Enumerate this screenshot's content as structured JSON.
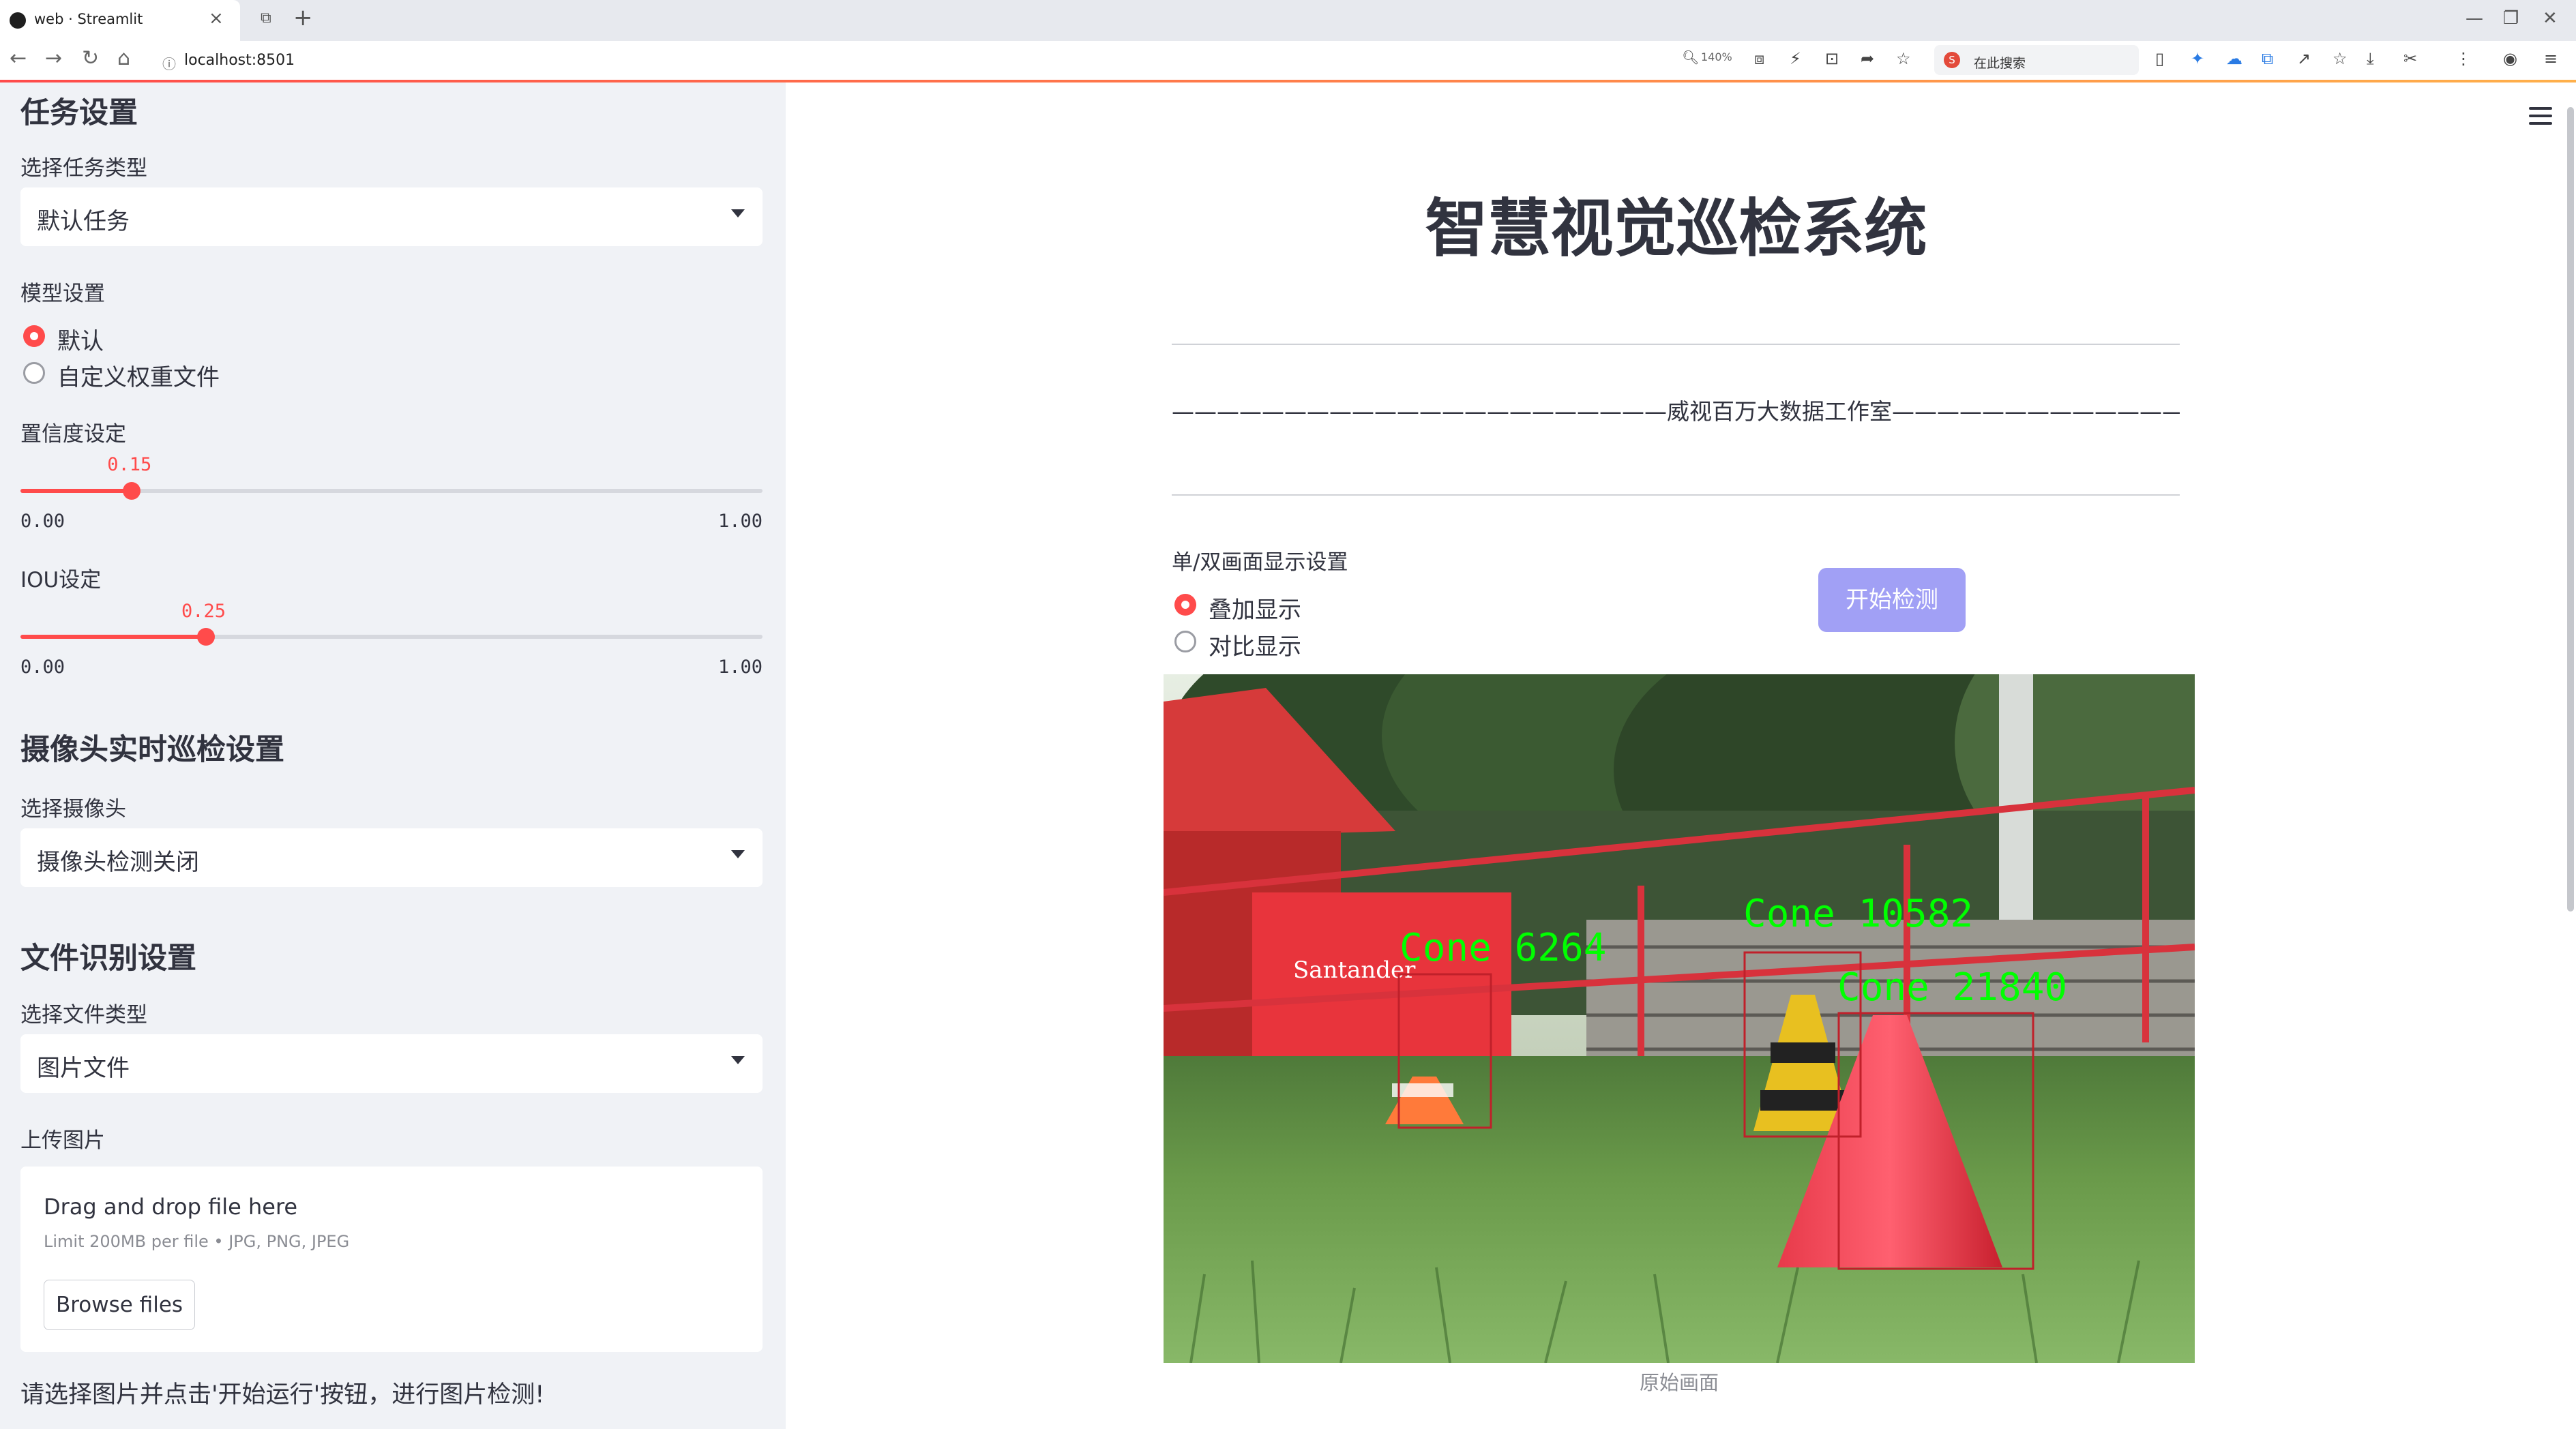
{
  "browser": {
    "tab_title": "web · Streamlit",
    "url": "localhost:8501",
    "zoom": "140%",
    "search_placeholder": "在此搜索"
  },
  "sidebar": {
    "task_section": {
      "heading": "任务设置",
      "select_label": "选择任务类型",
      "select_value": "默认任务"
    },
    "model_section": {
      "label": "模型设置",
      "options": [
        "默认",
        "自定义权重文件"
      ],
      "selected_index": 0
    },
    "confidence": {
      "label": "置信度设定",
      "value": "0.15",
      "value_num": 0.15,
      "min": "0.00",
      "max": "1.00"
    },
    "iou": {
      "label": "IOU设定",
      "value": "0.25",
      "value_num": 0.25,
      "min": "0.00",
      "max": "1.00"
    },
    "camera_section": {
      "heading": "摄像头实时巡检设置",
      "select_label": "选择摄像头",
      "select_value": "摄像头检测关闭"
    },
    "file_section": {
      "heading": "文件识别设置",
      "select_label": "选择文件类型",
      "select_value": "图片文件"
    },
    "upload": {
      "label": "上传图片",
      "drop_title": "Drag and drop file here",
      "limit_text": "Limit 200MB per file • JPG, PNG, JPEG",
      "browse_label": "Browse files"
    },
    "tip": "请选择图片并点击'开始运行'按钮，进行图片检测!"
  },
  "main": {
    "title": "智慧视觉巡检系统",
    "studio_line": "——————————————————————威视百万大数据工作室———————————————————————",
    "display_label": "单/双画面显示设置",
    "display_options": [
      "叠加显示",
      "对比显示"
    ],
    "display_selected_index": 0,
    "start_button": "开始检测",
    "caption": "原始画面",
    "detections": [
      {
        "label": "Cone 6264"
      },
      {
        "label": "Cone 10582"
      },
      {
        "label": "Cone 21840"
      }
    ],
    "banner_text": "Santander"
  },
  "colors": {
    "accent": "#ff4b4b",
    "start_button": "#a1a0f5",
    "sidebar_bg": "#f0f2f6",
    "detection_text": "#00ff00",
    "detection_box": "#c0202a"
  }
}
